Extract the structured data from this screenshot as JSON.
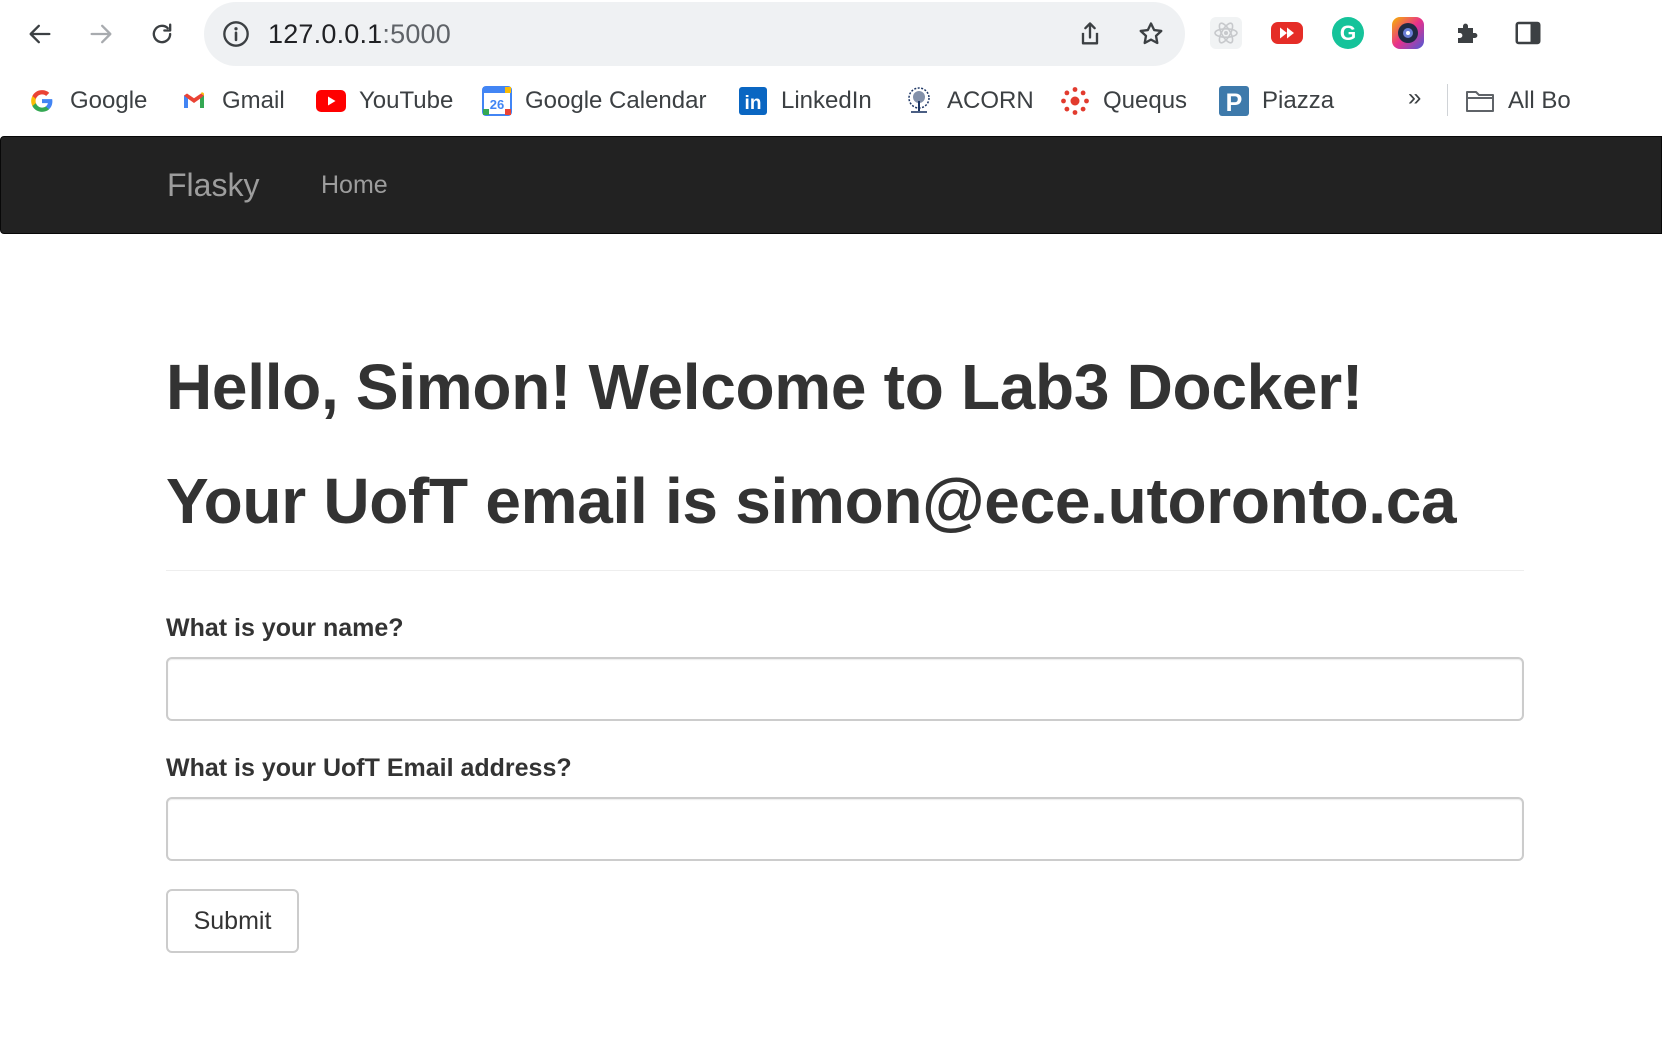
{
  "browser": {
    "address": {
      "host": "127.0.0.1",
      "port": ":5000"
    },
    "bookmarks": [
      {
        "label": "Google",
        "icon": "google-icon"
      },
      {
        "label": "Gmail",
        "icon": "gmail-icon"
      },
      {
        "label": "YouTube",
        "icon": "youtube-icon"
      },
      {
        "label": "Google Calendar",
        "icon": "google-calendar-icon",
        "badge": "26"
      },
      {
        "label": "LinkedIn",
        "icon": "linkedin-icon",
        "badge": "in"
      },
      {
        "label": "ACORN",
        "icon": "acorn-tree-icon"
      },
      {
        "label": "Quequs",
        "icon": "quercus-icon"
      },
      {
        "label": "Piazza",
        "icon": "piazza-icon",
        "badge": "P"
      }
    ],
    "bookmarks_overflow": "»",
    "all_bookmarks": "All Bo",
    "extensions": [
      "react-devtools-icon",
      "youtube-extension-icon",
      "grammarly-icon",
      "camera-extension-icon",
      "puzzle-icon",
      "side-panel-icon"
    ],
    "grammarly_letter": "G"
  },
  "navbar": {
    "brand": "Flasky",
    "home": "Home"
  },
  "main": {
    "greeting": "Hello, Simon! Welcome to Lab3 Docker!",
    "email_line": "Your UofT email is simon@ece.utoronto.ca",
    "form": {
      "name_label": "What is your name?",
      "name_value": "",
      "email_label": "What is your UofT Email address?",
      "email_value": "",
      "submit_label": "Submit"
    }
  },
  "colors": {
    "navbar_bg": "#222222",
    "navbar_text": "#9d9d9d",
    "text": "#333333"
  }
}
